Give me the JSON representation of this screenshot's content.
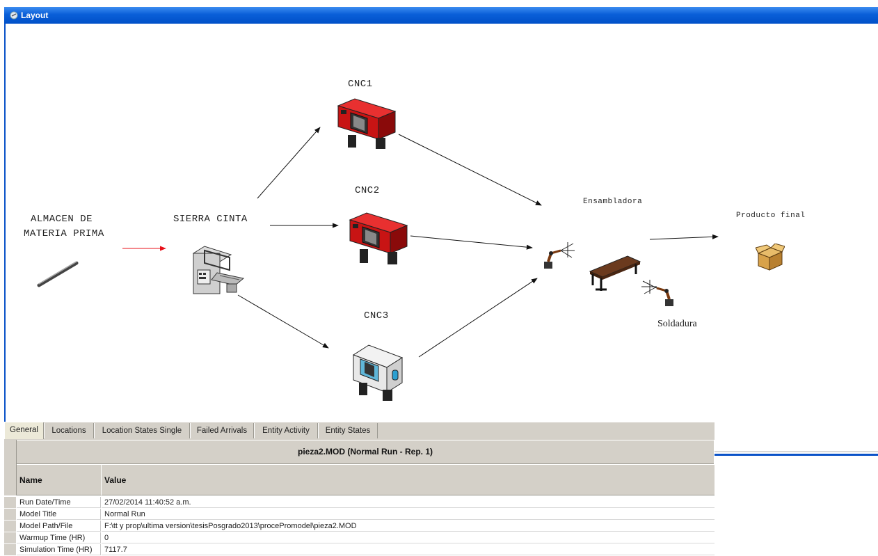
{
  "window": {
    "title": "Layout"
  },
  "layout": {
    "labels": {
      "almacen_line1": "ALMACEN DE",
      "almacen_line2": "MATERIA PRIMA",
      "sierra": "SIERRA CINTA",
      "cnc1": "CNC1",
      "cnc2": "CNC2",
      "cnc3": "CNC3",
      "ensambladora": "Ensambladora",
      "producto_final": "Producto final",
      "soldadura": "Soldadura"
    },
    "colors": {
      "arrow": "#111111",
      "input_arrow": "#e8101a",
      "cnc_red": "#d21a1a",
      "table_wood": "#6b3a1e"
    }
  },
  "report": {
    "tabs": [
      {
        "label": "General",
        "active": true
      },
      {
        "label": "Locations",
        "active": false
      },
      {
        "label": "Location States Single",
        "active": false
      },
      {
        "label": "Failed Arrivals",
        "active": false
      },
      {
        "label": "Entity Activity",
        "active": false
      },
      {
        "label": "Entity States",
        "active": false
      }
    ],
    "title": "pieza2.MOD (Normal Run - Rep. 1)",
    "columns": {
      "name": "Name",
      "value": "Value"
    },
    "rows": [
      {
        "name": "Run Date/Time",
        "value": "27/02/2014 11:40:52 a.m."
      },
      {
        "name": "Model Title",
        "value": "Normal Run"
      },
      {
        "name": "Model Path/File",
        "value": "F:\\tt y prop\\ultima version\\tesisPosgrado2013\\procePromodel\\pieza2.MOD"
      },
      {
        "name": "Warmup Time (HR)",
        "value": "0"
      },
      {
        "name": "Simulation Time (HR)",
        "value": "7117.7"
      }
    ]
  }
}
